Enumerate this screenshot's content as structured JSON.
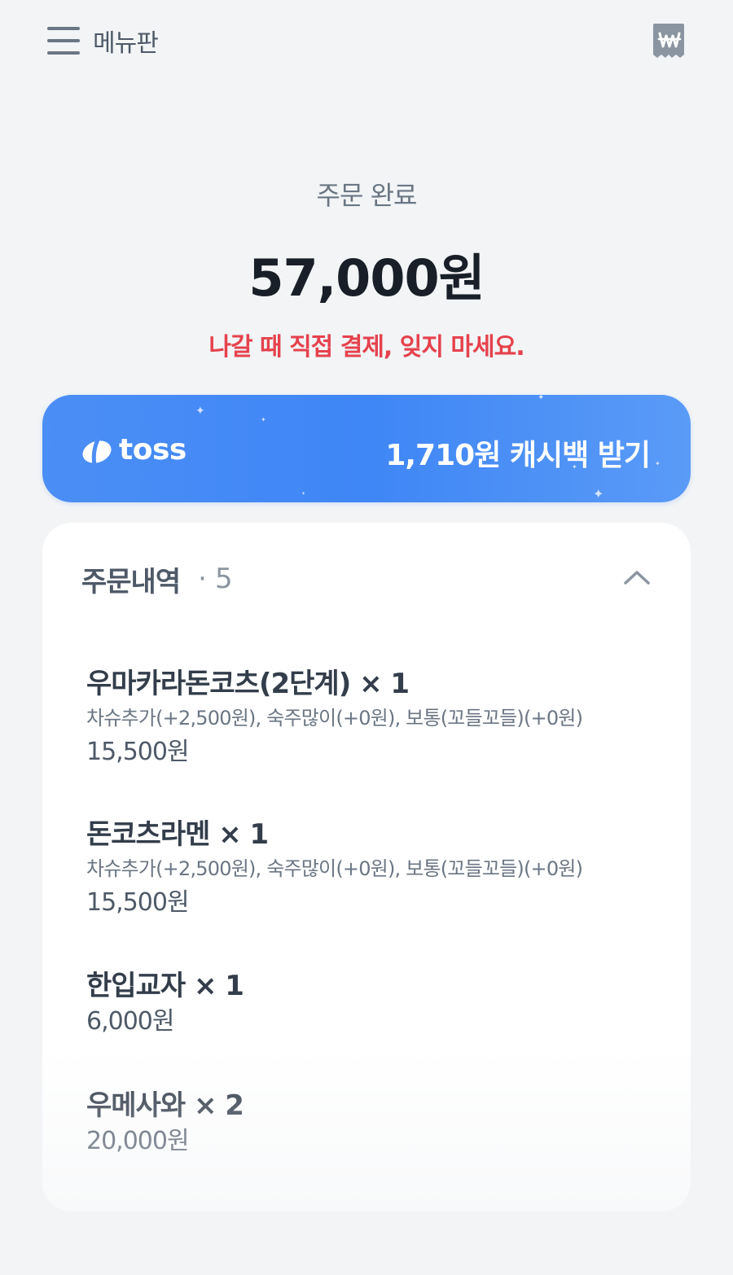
{
  "topbar": {
    "menu_label": "메뉴판",
    "menu_icon": "hamburger-icon",
    "won_icon": "won-receipt-icon"
  },
  "order": {
    "status": "주문 완료",
    "total": "57,000원",
    "notice": "나갈 때 직접 결제, 잊지 마세요."
  },
  "toss": {
    "brand": "toss",
    "cashback_label": "1,710원 캐시백 받기",
    "logo_icon": "toss-logo-icon",
    "color": "#3f86f6"
  },
  "details": {
    "title": "주문내역",
    "dot": "·",
    "count": "5",
    "toggle_icon": "chevron-up-icon",
    "items": [
      {
        "name": "우마카라돈코츠(2단계) × 1",
        "options": "차슈추가(+2,500원), 숙주많이(+0원), 보통(꼬들꼬들)(+0원)",
        "price": "15,500원"
      },
      {
        "name": "돈코츠라멘 × 1",
        "options": "차슈추가(+2,500원), 숙주많이(+0원), 보통(꼬들꼬들)(+0원)",
        "price": "15,500원"
      },
      {
        "name": "한입교자 × 1",
        "options": "",
        "price": "6,000원"
      },
      {
        "name": "우메사와 × 2",
        "options": "",
        "price": "20,000원"
      }
    ]
  },
  "colors": {
    "background": "#f2f4f6",
    "notice_red": "#e5424d",
    "toss_blue": "#3f86f6",
    "text_dark": "#191f28"
  }
}
